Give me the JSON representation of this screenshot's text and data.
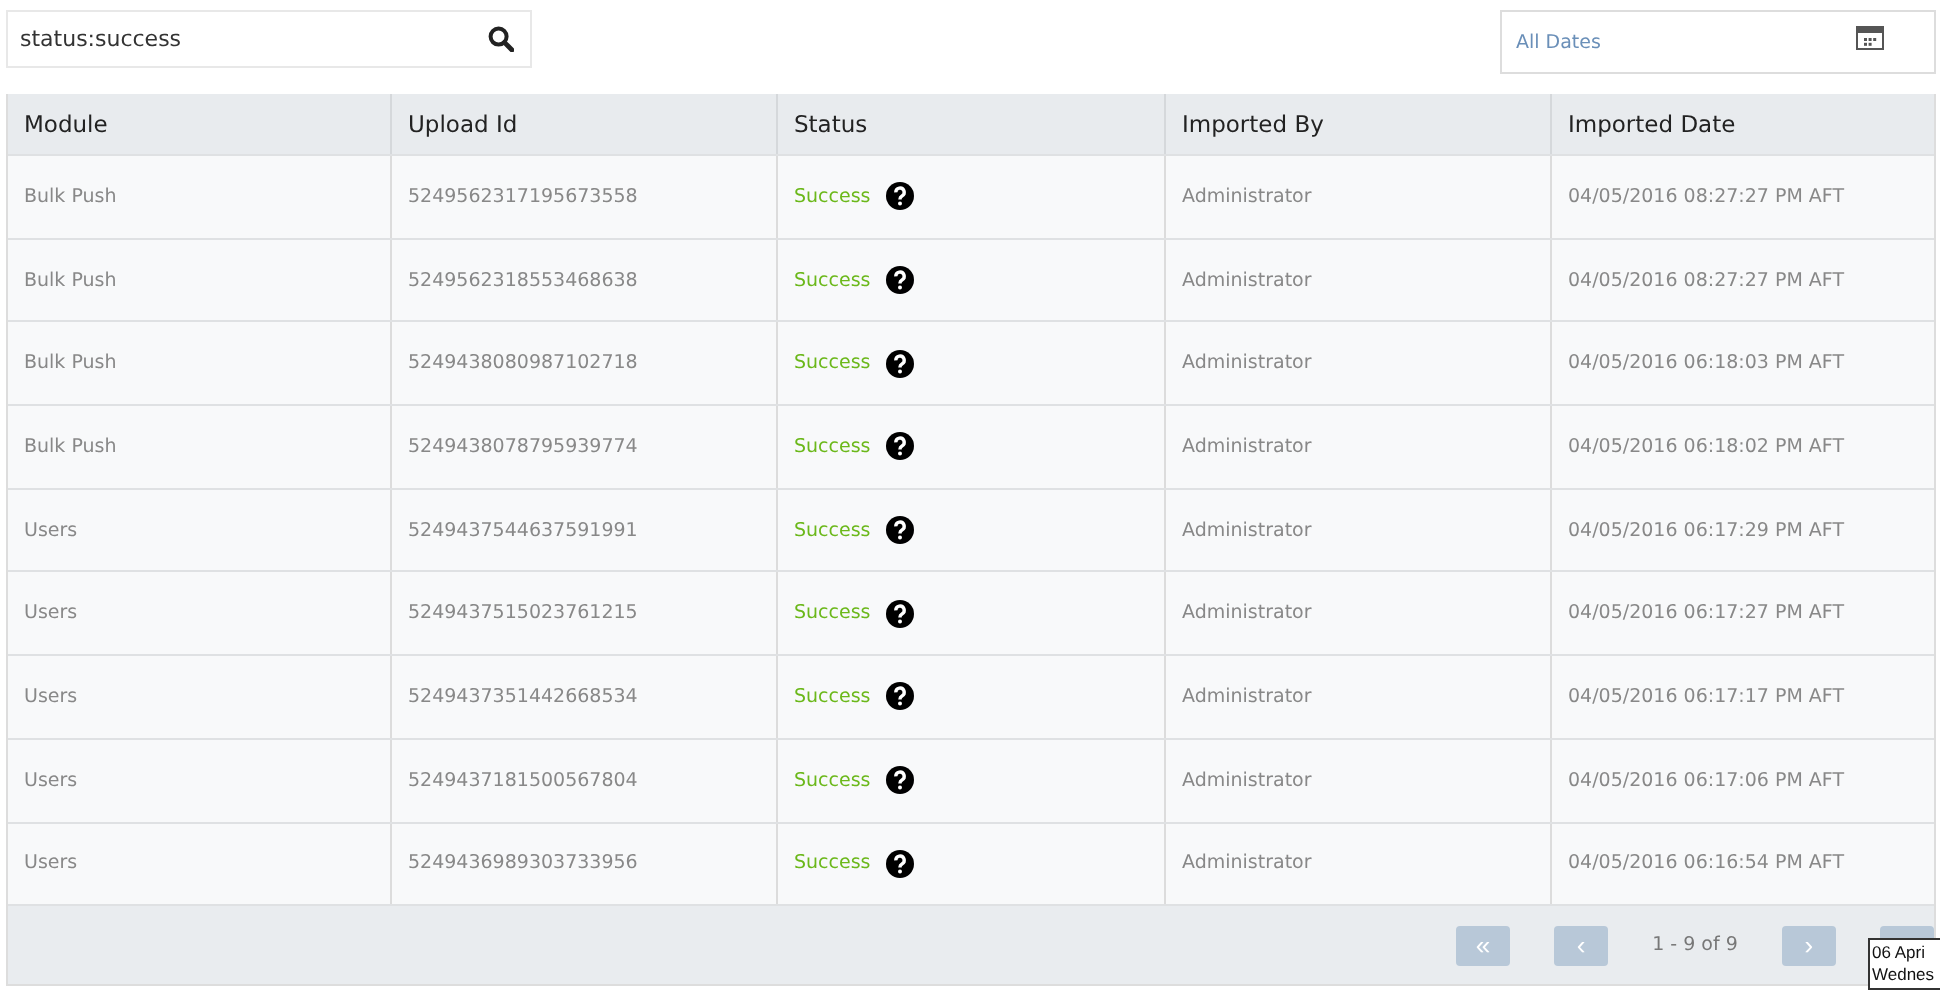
{
  "search": {
    "value": "status:success"
  },
  "date_filter": {
    "placeholder": "All Dates"
  },
  "table": {
    "columns": [
      "Module",
      "Upload Id",
      "Status",
      "Imported By",
      "Imported Date"
    ],
    "rows": [
      {
        "module": "Bulk Push",
        "upload_id": "5249562317195673558",
        "status": "Success",
        "imported_by": "Administrator",
        "imported_date": "04/05/2016 08:27:27 PM AFT"
      },
      {
        "module": "Bulk Push",
        "upload_id": "5249562318553468638",
        "status": "Success",
        "imported_by": "Administrator",
        "imported_date": "04/05/2016 08:27:27 PM AFT"
      },
      {
        "module": "Bulk Push",
        "upload_id": "5249438080987102718",
        "status": "Success",
        "imported_by": "Administrator",
        "imported_date": "04/05/2016 06:18:03 PM AFT"
      },
      {
        "module": "Bulk Push",
        "upload_id": "5249438078795939774",
        "status": "Success",
        "imported_by": "Administrator",
        "imported_date": "04/05/2016 06:18:02 PM AFT"
      },
      {
        "module": "Users",
        "upload_id": "5249437544637591991",
        "status": "Success",
        "imported_by": "Administrator",
        "imported_date": "04/05/2016 06:17:29 PM AFT"
      },
      {
        "module": "Users",
        "upload_id": "5249437515023761215",
        "status": "Success",
        "imported_by": "Administrator",
        "imported_date": "04/05/2016 06:17:27 PM AFT"
      },
      {
        "module": "Users",
        "upload_id": "5249437351442668534",
        "status": "Success",
        "imported_by": "Administrator",
        "imported_date": "04/05/2016 06:17:17 PM AFT"
      },
      {
        "module": "Users",
        "upload_id": "5249437181500567804",
        "status": "Success",
        "imported_by": "Administrator",
        "imported_date": "04/05/2016 06:17:06 PM AFT"
      },
      {
        "module": "Users",
        "upload_id": "5249436989303733956",
        "status": "Success",
        "imported_by": "Administrator",
        "imported_date": "04/05/2016 06:16:54 PM AFT"
      }
    ]
  },
  "pagination": {
    "first": {
      "label": "«",
      "disabled": true
    },
    "prev": {
      "label": "‹",
      "disabled": true
    },
    "range": "1 - 9 of 9",
    "next": {
      "label": "›",
      "disabled": true
    },
    "last": {
      "disabled": true
    }
  },
  "tooltip": {
    "lines": [
      "06 Apri",
      "Wednes"
    ]
  }
}
